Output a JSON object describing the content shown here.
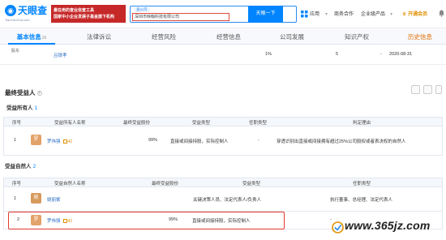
{
  "header": {
    "logo_text": "天眼查",
    "logo_sub": "TianYanCha.com",
    "promo": {
      "line1": "最在用的查业信查工具",
      "line2": "国家中小企业发展子基金旗下机构"
    },
    "search": {
      "tag": "查公司",
      "value": "深圳市映翰科技有限公司",
      "button": "天眼一下"
    },
    "nav": {
      "app": "应用",
      "coop": "商务合作",
      "enterprise": "企业级产品",
      "vip": "开通会员"
    }
  },
  "tabs": [
    {
      "label": "基本信息",
      "count": "26",
      "active": true
    },
    {
      "label": "法律诉讼",
      "count": "",
      "active": false
    },
    {
      "label": "经营风险",
      "count": "",
      "active": false
    },
    {
      "label": "经营信息",
      "count": "",
      "active": false
    },
    {
      "label": "公司发展",
      "count": "",
      "active": false
    },
    {
      "label": "知识产权",
      "count": "",
      "active": false
    },
    {
      "label": "历史信息",
      "count": "",
      "active": false
    }
  ],
  "partial_row": {
    "left": "股东",
    "name": "吕铁孝",
    "percent": "1%",
    "count": "5",
    "dash": "-",
    "date": "2020-08-31"
  },
  "section": {
    "title": "最终受益人",
    "owners": {
      "title": "受益所有人",
      "count": "1",
      "headers": [
        "序号",
        "受益所有人名称",
        "最终受益股份",
        "受益类型",
        "任职类型",
        "判定理由"
      ],
      "rows": [
        {
          "index": "1",
          "avatar": "罗",
          "avatar_color": "#e3a26a",
          "name": "罗伟强",
          "badge": "42",
          "share": "99%",
          "type": "直接或间接持股，实际控制人",
          "role": "-",
          "reason": "穿透识别出直接或间接拥有超过25%公司股权或者表决权的自然人"
        }
      ]
    },
    "naturals": {
      "title": "受益自然人",
      "count": "2",
      "headers": [
        "序号",
        "受益自然人名称",
        "最终受益股份",
        "受益类型",
        "任职类型"
      ],
      "rows": [
        {
          "index": "1",
          "avatar": "姚",
          "avatar_color": "#d69a5d",
          "name": "姚丽紫",
          "badge": "",
          "share": "",
          "type": "关键决策人员、法定代表人/负责人",
          "role": "执行董事、总经理、法定代表人"
        },
        {
          "index": "2",
          "avatar": "罗",
          "avatar_color": "#e3a26a",
          "name": "罗伟强",
          "badge": "42",
          "share": "99%",
          "type": "直接或间接持股，实际控制人",
          "role": "-"
        }
      ]
    }
  },
  "watermark": "www.365jz.com",
  "colors": {
    "brand": "#0084ff",
    "promo": "#c62828",
    "highlight": "#e03a2f",
    "link": "#2b6cc4",
    "vip": "#e08f00"
  }
}
